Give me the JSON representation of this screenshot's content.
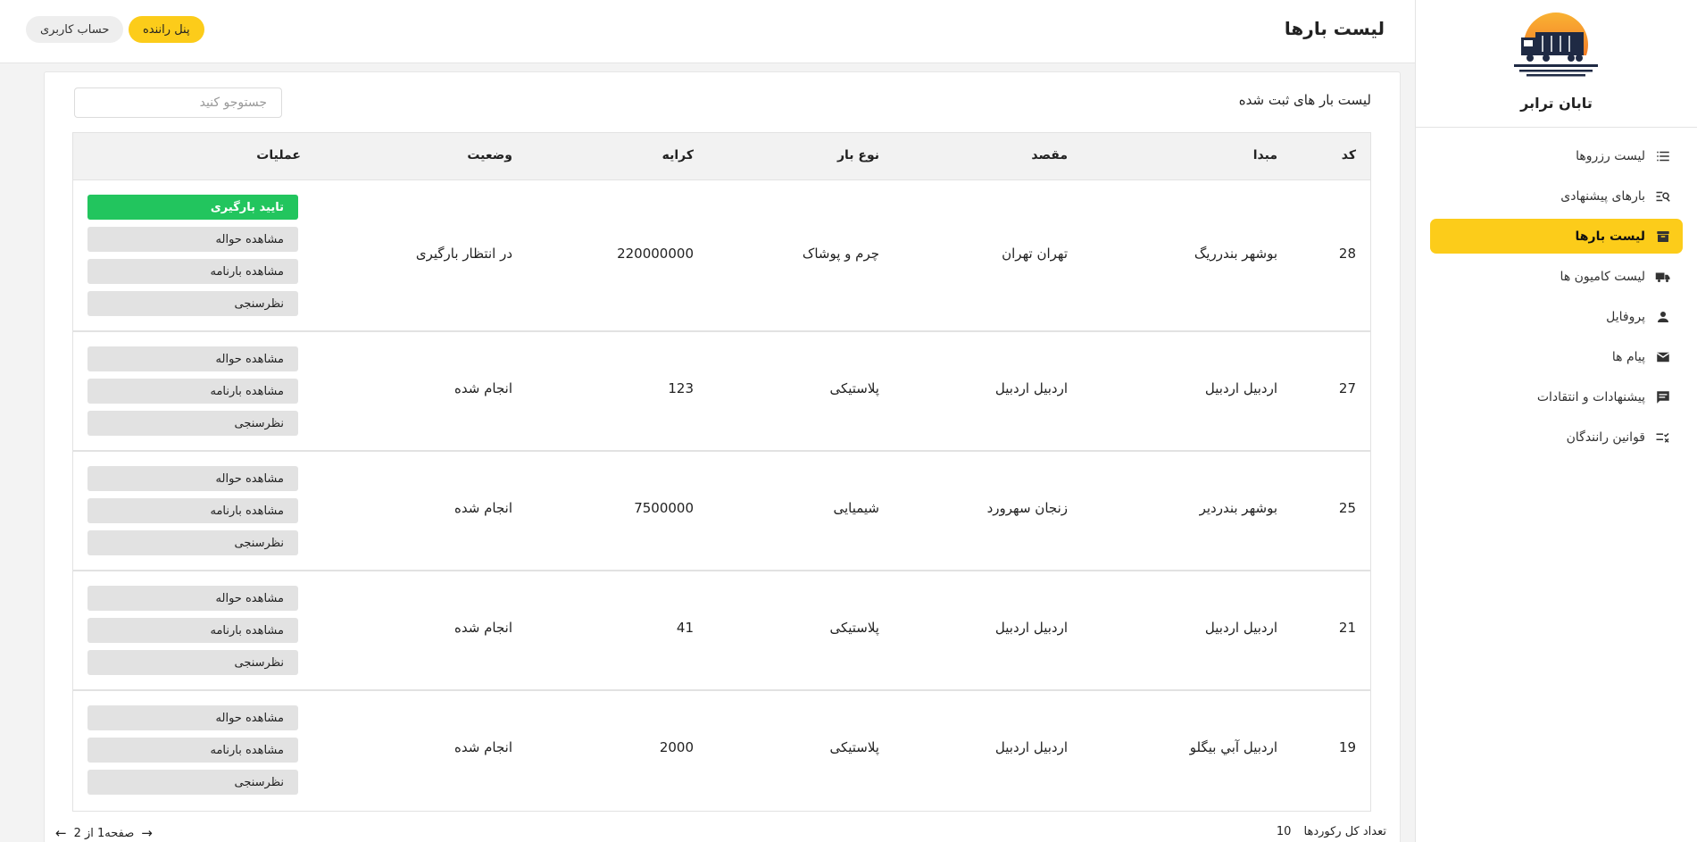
{
  "brand": {
    "name": "تابان ترابر"
  },
  "sidebar": {
    "items": [
      {
        "label": "لیست رزروها",
        "icon": "list-icon",
        "active": false
      },
      {
        "label": "بارهای پیشنهادی",
        "icon": "search-list-icon",
        "active": false
      },
      {
        "label": "لیست بارها",
        "icon": "archive-box-icon",
        "active": true
      },
      {
        "label": "لیست کامیون ها",
        "icon": "truck-icon",
        "active": false
      },
      {
        "label": "پروفایل",
        "icon": "person-icon",
        "active": false
      },
      {
        "label": "پیام ها",
        "icon": "mail-icon",
        "active": false
      },
      {
        "label": "پیشنهادات و انتقادات",
        "icon": "comment-icon",
        "active": false
      },
      {
        "label": "قوانین رانندگان",
        "icon": "checklist-icon",
        "active": false
      }
    ]
  },
  "header": {
    "title": "لیست بارها",
    "driver_panel": "پنل راننده",
    "account": "حساب کاربری"
  },
  "main": {
    "card_title": "لیست بار های ثبت شده",
    "search_placeholder": "جستوجو کنید",
    "columns": [
      "کد",
      "مبدا",
      "مقصد",
      "نوع بار",
      "کرایه",
      "وضعیت",
      "عملیات"
    ],
    "rows": [
      {
        "code": "28",
        "origin": "بوشهر بندرریگ",
        "dest": "تهران تهران",
        "type": "چرم و پوشاک",
        "fare": "220000000",
        "status": "در انتظار بارگیری",
        "actions": [
          "تایید بارگیری",
          "مشاهده حواله",
          "مشاهده بارنامه",
          "نظرسنجی"
        ]
      },
      {
        "code": "27",
        "origin": "اردبيل اردبيل",
        "dest": "اردبيل اردبيل",
        "type": "پلاستیکی",
        "fare": "123",
        "status": "انجام شده",
        "actions": [
          "مشاهده حواله",
          "مشاهده بارنامه",
          "نظرسنجی"
        ]
      },
      {
        "code": "25",
        "origin": "بوشهر بندردیر",
        "dest": "زنجان سهرورد",
        "type": "شیمیایی",
        "fare": "7500000",
        "status": "انجام شده",
        "actions": [
          "مشاهده حواله",
          "مشاهده بارنامه",
          "نظرسنجی"
        ]
      },
      {
        "code": "21",
        "origin": "اردبيل اردبيل",
        "dest": "اردبيل اردبيل",
        "type": "پلاستیکی",
        "fare": "41",
        "status": "انجام شده",
        "actions": [
          "مشاهده حواله",
          "مشاهده بارنامه",
          "نظرسنجی"
        ]
      },
      {
        "code": "19",
        "origin": "اردبيل آبي بيگلو",
        "dest": "اردبيل اردبيل",
        "type": "پلاستیکی",
        "fare": "2000",
        "status": "انجام شده",
        "actions": [
          "مشاهده حواله",
          "مشاهده بارنامه",
          "نظرسنجی"
        ]
      }
    ],
    "total_label": "تعداد کل رکوردها",
    "total_value": "10",
    "page_label": "صفحه1 از 2"
  },
  "colors": {
    "accent": "#fccc1a",
    "confirm": "#22c55e",
    "logo_sun": "#f7941d"
  }
}
